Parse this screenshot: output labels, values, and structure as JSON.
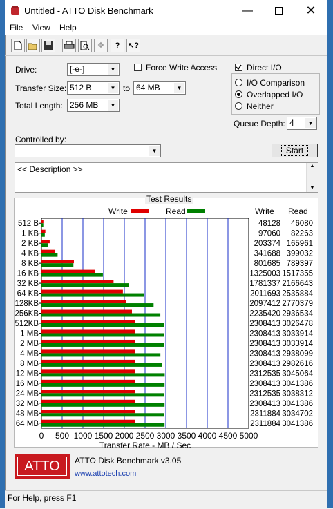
{
  "window": {
    "title": "Untitled - ATTO Disk Benchmark"
  },
  "menu": {
    "file": "File",
    "view": "View",
    "help": "Help"
  },
  "form": {
    "drive_label": "Drive:",
    "drive_value": "[-e-]",
    "force_write_label": "Force Write Access",
    "force_write_checked": false,
    "direct_io_label": "Direct I/O",
    "direct_io_checked": true,
    "transfer_size_label": "Transfer Size:",
    "transfer_from": "512 B",
    "to_label": "to",
    "transfer_to": "64 MB",
    "total_length_label": "Total Length:",
    "total_length": "256 MB",
    "io_comparison": "I/O Comparison",
    "overlapped_io": "Overlapped I/O",
    "neither": "Neither",
    "selected_mode": "Overlapped I/O",
    "queue_depth_label": "Queue Depth:",
    "queue_depth": "4",
    "controlled_by_label": "Controlled by:",
    "controlled_by_value": "",
    "start_label": "Start",
    "description": "<< Description >>"
  },
  "results": {
    "title": "Test Results",
    "write_legend": "Write",
    "read_legend": "Read",
    "write_col": "Write",
    "read_col": "Read"
  },
  "chart_data": {
    "type": "bar",
    "orientation": "horizontal",
    "categories": [
      "512 B",
      "1 KB",
      "2 KB",
      "4 KB",
      "8 KB",
      "16 KB",
      "32 KB",
      "64 KB",
      "128KB",
      "256KB",
      "512KB",
      "1 MB",
      "2 MB",
      "4 MB",
      "8 MB",
      "12 MB",
      "16 MB",
      "24 MB",
      "32 MB",
      "48 MB",
      "64 MB"
    ],
    "series": [
      {
        "name": "Write",
        "color": "#e00000",
        "values": [
          48128,
          97060,
          203374,
          341688,
          801685,
          1325003,
          1781337,
          2011693,
          2097412,
          2235420,
          2308413,
          2308413,
          2308413,
          2308413,
          2308413,
          2312535,
          2308413,
          2312535,
          2308413,
          2311884,
          2311884
        ]
      },
      {
        "name": "Read",
        "color": "#008000",
        "values": [
          46080,
          82263,
          165961,
          399032,
          789397,
          1517355,
          2166643,
          2535884,
          2770379,
          2936534,
          3026478,
          3033914,
          3033914,
          2938099,
          2982616,
          3045064,
          3041386,
          3038312,
          3041386,
          3034702,
          3041386
        ]
      }
    ],
    "xlabel": "Transfer Rate - MB / Sec",
    "xticks": [
      "0",
      "500",
      "1000",
      "1500",
      "2000",
      "2500",
      "3000",
      "3500",
      "4000",
      "4500",
      "5000"
    ],
    "xlim": [
      0,
      5000
    ],
    "grid": true,
    "legend": "top"
  },
  "footer": {
    "logo": "ATTO",
    "app_name": "ATTO Disk Benchmark v3.05",
    "url": "www.attotech.com"
  },
  "status": {
    "text": "For Help, press F1"
  }
}
